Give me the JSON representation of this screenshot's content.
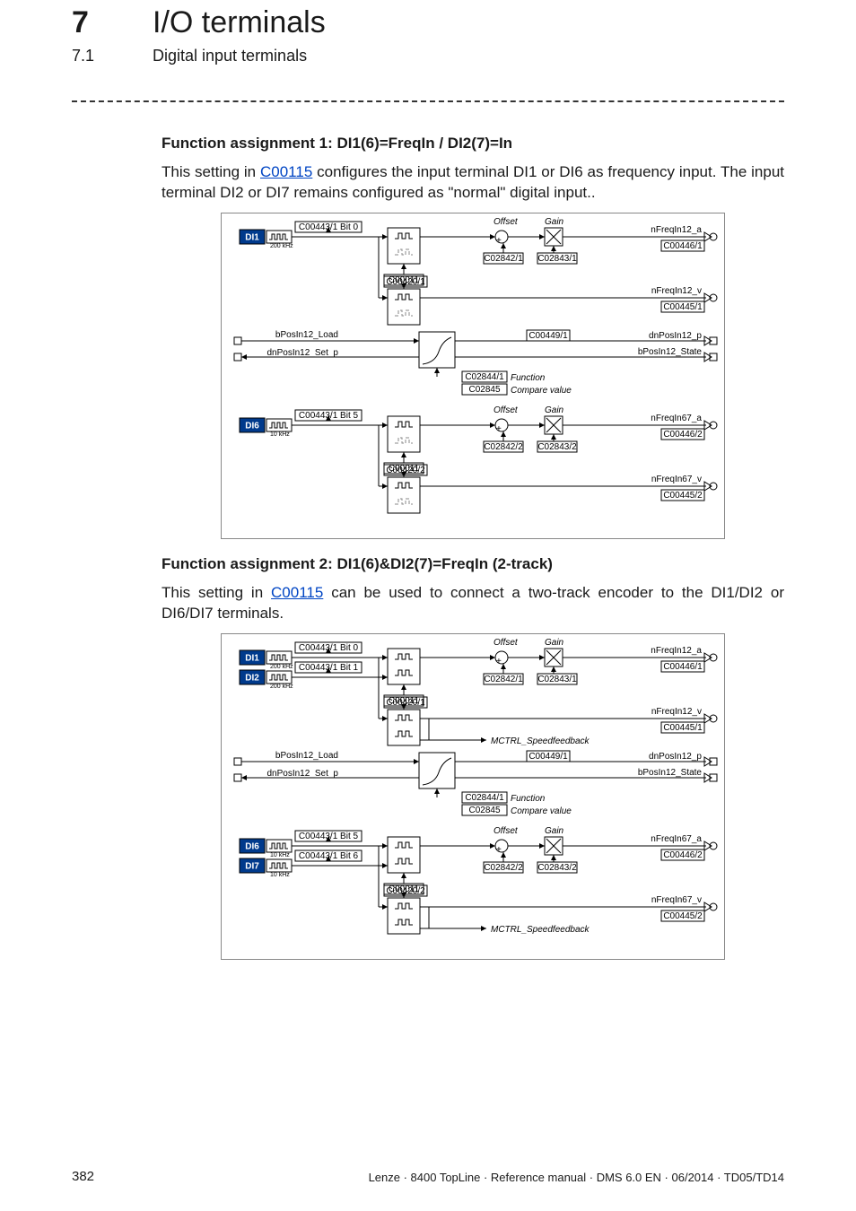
{
  "chapter": {
    "num": "7",
    "title": "I/O terminals"
  },
  "section": {
    "num": "7.1",
    "title": "Digital input terminals"
  },
  "block1": {
    "heading": "Function assignment 1: DI1(6)=FreqIn / DI2(7)=In",
    "para_pre": "This setting in ",
    "link": "C00115",
    "para_post": " configures the input terminal DI1 or DI6 as frequency input. The input terminal DI2 or DI7 remains configured as \"normal\" digital input.."
  },
  "block2": {
    "heading": "Function assignment 2: DI1(6)&DI2(7)=FreqIn (2-track)",
    "para_pre": "This setting in ",
    "link": "C00115",
    "para_post": "  can be used to connect a two-track encoder to the DI1/DI2 or DI6/DI7 terminals."
  },
  "diagram1": {
    "channels": [
      {
        "inputs": [
          {
            "label": "DI1",
            "freq": "200 kHz"
          }
        ],
        "bit_labels": [
          "C00443/1 Bit 0"
        ],
        "filter_param": "C00011",
        "velparam": "C00420/1",
        "offset_lbl": "Offset",
        "gain_lbl": "Gain",
        "offset_param": "C02842/1",
        "gain_param": "C02843/1",
        "out_a": "nFreqIn12_a",
        "out_a_param": "C00446/1",
        "out_v": "nFreqIn12_v",
        "out_v_param": "C00445/1",
        "load": "bPosIn12_Load",
        "set": "dnPosIn12_Set_p",
        "pos_out": "dnPosIn12_p",
        "pos_out_param": "C00449/1",
        "state_out": "bPosIn12_State",
        "func_param": "C02844/1",
        "func_lbl": "Function",
        "cmp_param": "C02845",
        "cmp_lbl": "Compare value",
        "two_track": false
      },
      {
        "inputs": [
          {
            "label": "DI6",
            "freq": "10 kHz"
          }
        ],
        "bit_labels": [
          "C00443/1 Bit 5"
        ],
        "filter_param": "C00011",
        "velparam": "C00420/2",
        "offset_lbl": "Offset",
        "gain_lbl": "Gain",
        "offset_param": "C02842/2",
        "gain_param": "C02843/2",
        "out_a": "nFreqIn67_a",
        "out_a_param": "C00446/2",
        "out_v": "nFreqIn67_v",
        "out_v_param": "C00445/2",
        "two_track": false
      }
    ]
  },
  "diagram2": {
    "channels": [
      {
        "inputs": [
          {
            "label": "DI1",
            "freq": "200 kHz"
          },
          {
            "label": "DI2",
            "freq": "200 kHz"
          }
        ],
        "bit_labels": [
          "C00443/1 Bit 0",
          "C00443/1 Bit 1"
        ],
        "filter_param": "C00011",
        "velparam": "C00420/1",
        "offset_lbl": "Offset",
        "gain_lbl": "Gain",
        "offset_param": "C02842/1",
        "gain_param": "C02843/1",
        "out_a": "nFreqIn12_a",
        "out_a_param": "C00446/1",
        "out_v": "nFreqIn12_v",
        "out_v_param": "C00445/1",
        "speed_lbl": "MCTRL_Speedfeedback",
        "load": "bPosIn12_Load",
        "set": "dnPosIn12_Set_p",
        "pos_out": "dnPosIn12_p",
        "pos_out_param": "C00449/1",
        "state_out": "bPosIn12_State",
        "func_param": "C02844/1",
        "func_lbl": "Function",
        "cmp_param": "C02845",
        "cmp_lbl": "Compare value",
        "two_track": true
      },
      {
        "inputs": [
          {
            "label": "DI6",
            "freq": "10 kHz"
          },
          {
            "label": "DI7",
            "freq": "10 kHz"
          }
        ],
        "bit_labels": [
          "C00443/1 Bit 5",
          "C00443/1 Bit 6"
        ],
        "filter_param": "C00011",
        "velparam": "C00420/2",
        "offset_lbl": "Offset",
        "gain_lbl": "Gain",
        "offset_param": "C02842/2",
        "gain_param": "C02843/2",
        "out_a": "nFreqIn67_a",
        "out_a_param": "C00446/2",
        "out_v": "nFreqIn67_v",
        "out_v_param": "C00445/2",
        "speed_lbl": "MCTRL_Speedfeedback",
        "two_track": true
      }
    ]
  },
  "footer": {
    "page": "382",
    "right": "Lenze · 8400 TopLine · Reference manual · DMS 6.0 EN · 06/2014 · TD05/TD14"
  }
}
